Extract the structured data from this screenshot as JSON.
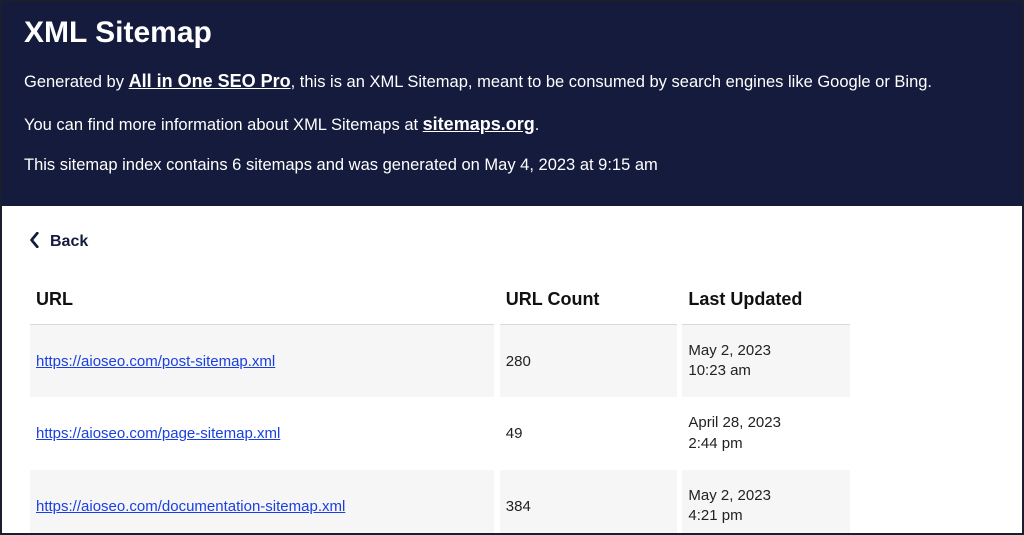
{
  "header": {
    "title": "XML Sitemap",
    "gen_prefix": "Generated by ",
    "gen_link": "All in One SEO Pro",
    "gen_suffix": ", this is an XML Sitemap, meant to be consumed by search engines like Google or Bing.",
    "info_prefix": "You can find more information about XML Sitemaps at ",
    "info_link": "sitemaps.org",
    "info_suffix": ".",
    "summary": "This sitemap index contains 6 sitemaps and was generated on May 4, 2023 at 9:15 am"
  },
  "nav": {
    "back": "Back"
  },
  "table": {
    "headers": {
      "url": "URL",
      "count": "URL Count",
      "updated": "Last Updated"
    },
    "rows": [
      {
        "url": "https://aioseo.com/post-sitemap.xml",
        "count": "280",
        "date": "May 2, 2023",
        "time": "10:23 am"
      },
      {
        "url": "https://aioseo.com/page-sitemap.xml",
        "count": "49",
        "date": "April 28, 2023",
        "time": "2:44 pm"
      },
      {
        "url": "https://aioseo.com/documentation-sitemap.xml",
        "count": "384",
        "date": "May 2, 2023",
        "time": "4:21 pm"
      }
    ]
  }
}
